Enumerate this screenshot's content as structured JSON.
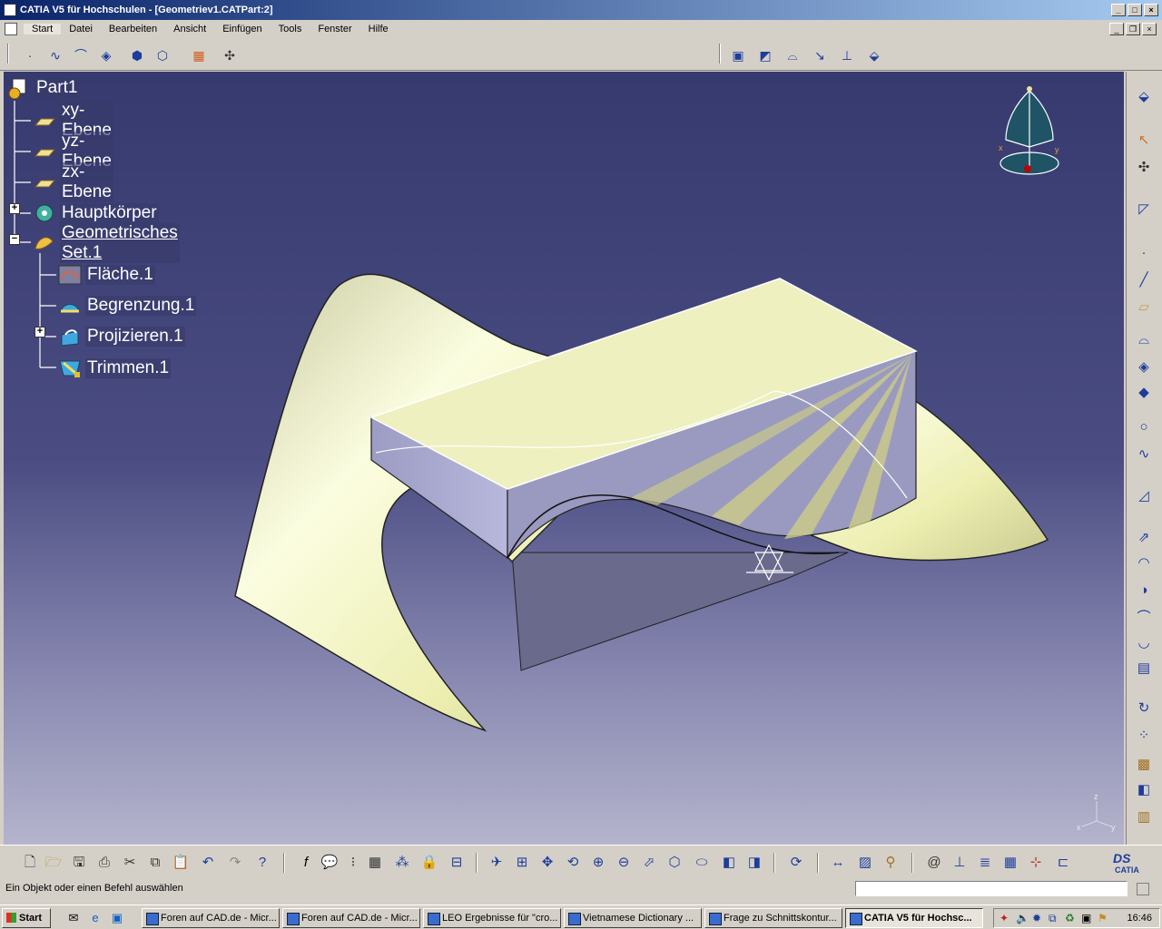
{
  "window": {
    "title": "CATIA V5 für Hochschulen - [Geometriev1.CATPart:2]"
  },
  "menu": [
    "Start",
    "Datei",
    "Bearbeiten",
    "Ansicht",
    "Einfügen",
    "Tools",
    "Fenster",
    "Hilfe"
  ],
  "tree": {
    "root": "Part1",
    "items": [
      "xy-Ebene",
      "yz-Ebene",
      "zx-Ebene",
      "Hauptkörper",
      "Geometrisches Set.1"
    ],
    "children": [
      "Fläche.1",
      "Begrenzung.1",
      "Projizieren.1",
      "Trimmen.1"
    ]
  },
  "compass": {
    "x_label": "x",
    "y_label": "y"
  },
  "axis_triad": {
    "z": "z",
    "x": "x",
    "y": "y"
  },
  "status": {
    "message": "Ein Objekt oder einen Befehl auswählen",
    "command": ""
  },
  "brand": {
    "logo": "CATIA",
    "logo_prefix": "DS"
  },
  "taskbar": {
    "start": "Start",
    "tasks": [
      "Foren auf CAD.de - Micr...",
      "Foren auf CAD.de - Micr...",
      "LEO Ergebnisse für \"cro...",
      "Vietnamese Dictionary ...",
      "Frage zu Schnittskontur...",
      "CATIA V5 für Hochsc..."
    ],
    "clock": "16:46"
  },
  "colors": {
    "viewport_top": "#363a6e",
    "surface": "#eef0b8",
    "title_grad": "#0a246a"
  }
}
